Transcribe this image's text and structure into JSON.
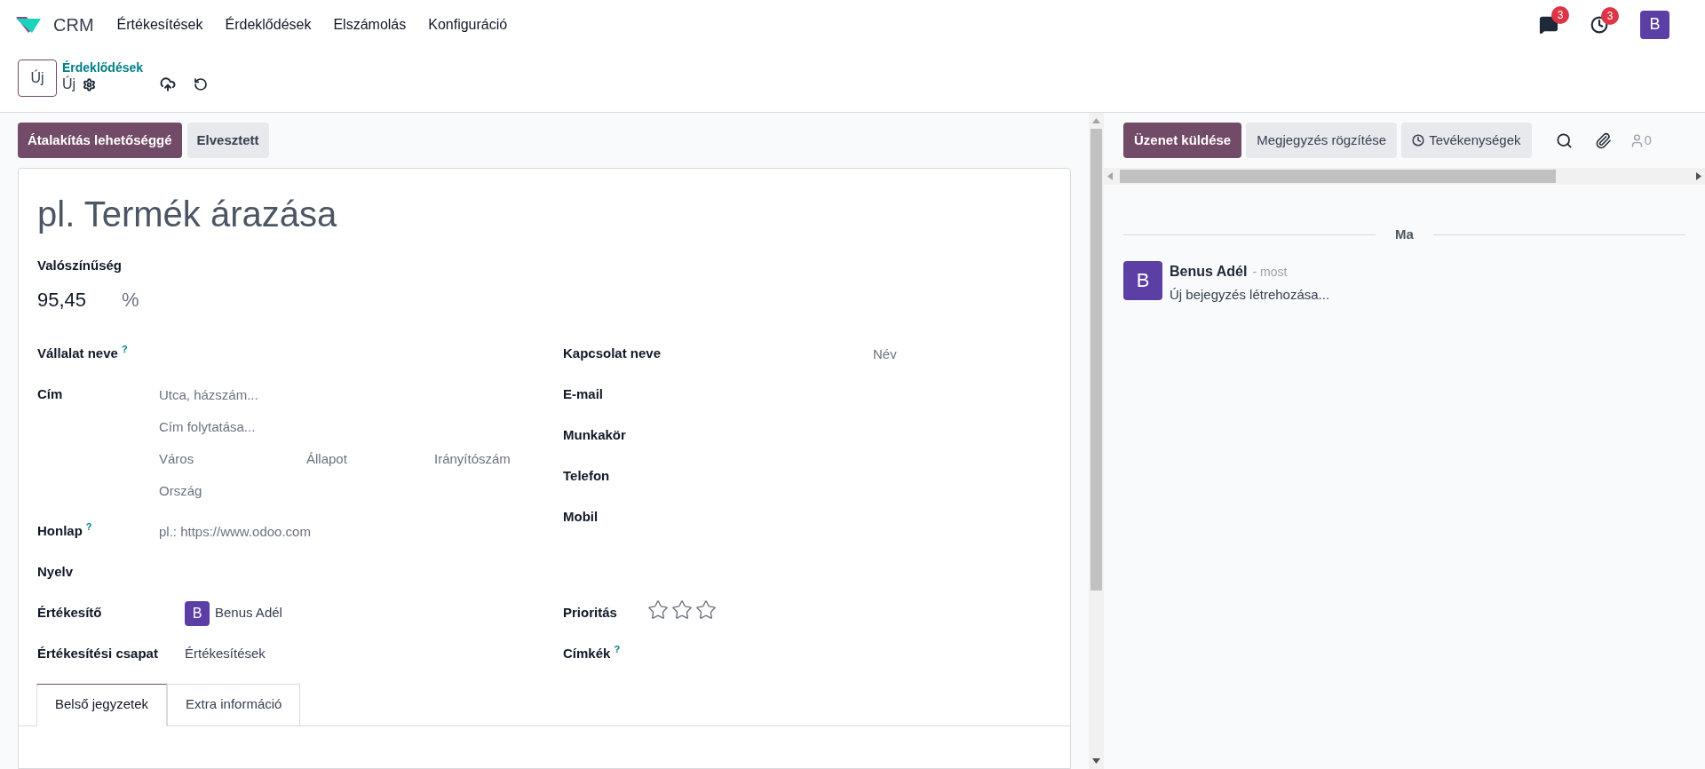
{
  "navbar": {
    "app_name": "CRM",
    "menu": [
      "Értékesítések",
      "Érdeklődések",
      "Elszámolás",
      "Konfiguráció"
    ],
    "messages_badge": "3",
    "activities_badge": "3",
    "user_avatar": "B"
  },
  "control_panel": {
    "new_button": "Új",
    "breadcrumb": "Érdeklődések",
    "record_name": "Új"
  },
  "action_buttons": [
    {
      "label": "Átalakítás lehetőséggé",
      "kind": "primary"
    },
    {
      "label": "Elvesztett",
      "kind": "secondary"
    }
  ],
  "form": {
    "title_placeholder": "pl. Termék árazása",
    "probability": {
      "label": "Valószínűség",
      "value": "95,45",
      "unit": "%"
    },
    "left_fields": [
      {
        "kind": "text",
        "label": "Vállalat neve",
        "help": "?"
      },
      {
        "kind": "address",
        "label": "Cím",
        "lines": [
          {
            "parts": [
              {
                "placeholder": "Utca, házszám..."
              }
            ]
          },
          {
            "parts": [
              {
                "placeholder": "Cím folytatása..."
              }
            ]
          },
          {
            "parts": [
              {
                "placeholder": "Város"
              },
              {
                "placeholder": "Állapot"
              },
              {
                "placeholder": "Irányítószám"
              }
            ]
          },
          {
            "parts": [
              {
                "placeholder": "Ország"
              }
            ]
          }
        ]
      },
      {
        "kind": "text",
        "label": "Honlap",
        "help": "?",
        "placeholder": "pl.: https://www.odoo.com"
      },
      {
        "kind": "text",
        "label": "Nyelv"
      },
      {
        "kind": "user",
        "label": "Értékesítő",
        "avatar": "B",
        "value": "Benus Adél"
      },
      {
        "kind": "text",
        "label": "Értékesítési csapat",
        "value": "Értékesítések"
      }
    ],
    "right_fields": [
      {
        "kind": "text",
        "label": "Kapcsolat neve",
        "placeholder": "Név"
      },
      {
        "kind": "text",
        "label": "E-mail"
      },
      {
        "kind": "text",
        "label": "Munkakör"
      },
      {
        "kind": "text",
        "label": "Telefon"
      },
      {
        "kind": "text",
        "label": "Mobil"
      },
      {
        "kind": "priority",
        "label": "Prioritás",
        "stars": 0
      },
      {
        "kind": "text",
        "label": "Címkék",
        "help": "?"
      }
    ],
    "tabs": [
      {
        "label": "Belső jegyzetek",
        "selected": true
      },
      {
        "label": "Extra információ",
        "selected": false
      }
    ]
  },
  "chatter": {
    "buttons": [
      {
        "label": "Üzenet küldése",
        "kind": "primary"
      },
      {
        "label": "Megjegyzés rögzítése",
        "kind": "secondary"
      },
      {
        "label": "Tevékenységek",
        "kind": "activity"
      }
    ],
    "followers_count": "0",
    "date_separator": "Ma",
    "messages": [
      {
        "avatar": "B",
        "author": "Benus Adél",
        "time": "- most",
        "body": "Új bejegyzés létrehozása..."
      }
    ]
  }
}
